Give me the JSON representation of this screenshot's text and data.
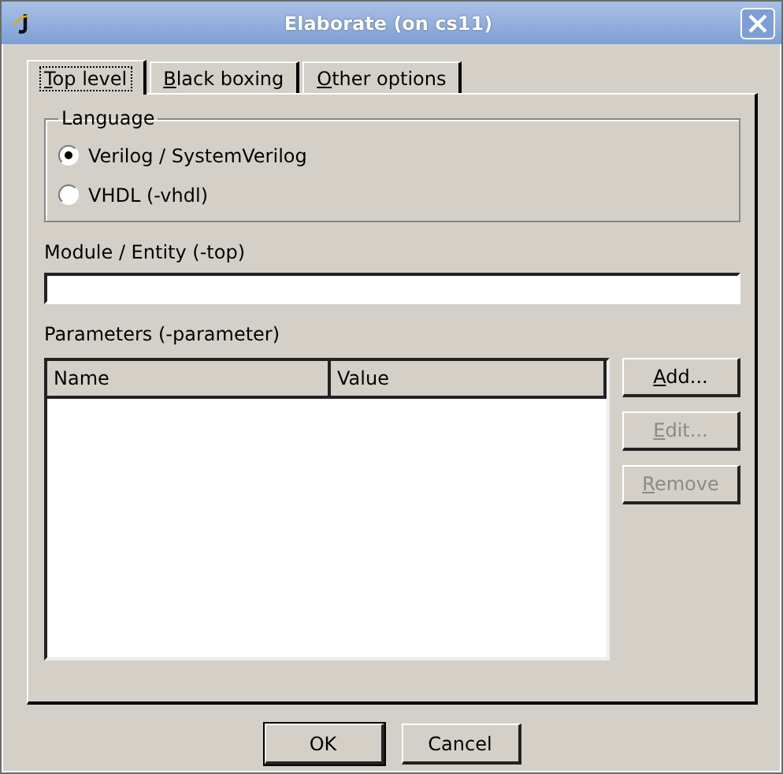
{
  "window": {
    "title": "Elaborate (on cs11)"
  },
  "tabs": [
    {
      "label": "Top level",
      "selected": true,
      "underline_first": true
    },
    {
      "label": "Black boxing",
      "selected": false,
      "underline_first": true
    },
    {
      "label": "Other options",
      "selected": false,
      "underline_first": true
    }
  ],
  "language": {
    "title": "Language",
    "options": [
      {
        "label": "Verilog / SystemVerilog",
        "selected": true
      },
      {
        "label": "VHDL (-vhdl)",
        "selected": false
      }
    ]
  },
  "module": {
    "label": "Module / Entity (-top)"
  },
  "parameters": {
    "label": "Parameters (-parameter)",
    "columns": [
      "Name",
      "Value"
    ],
    "buttons": [
      {
        "label": "Add...",
        "disabled": false,
        "underline_first": true
      },
      {
        "label": "Edit...",
        "disabled": true,
        "underline_first": true
      },
      {
        "label": "Remove",
        "disabled": true,
        "underline_first": true
      }
    ]
  },
  "buttons": [
    {
      "label": "OK",
      "default": true
    },
    {
      "label": "Cancel",
      "default": false
    }
  ]
}
